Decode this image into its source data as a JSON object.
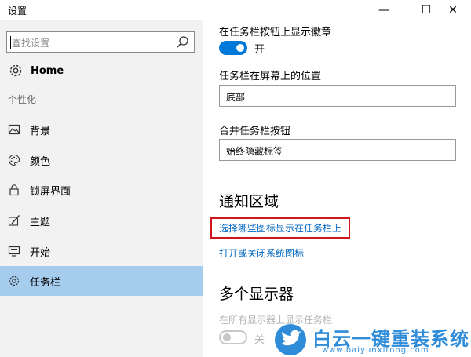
{
  "window": {
    "title": "设置",
    "minimize": "—",
    "maximize": "☐",
    "close": "✕"
  },
  "sidebar": {
    "search_placeholder": "查找设置",
    "home_label": "Home",
    "section_label": "个性化",
    "items": [
      {
        "label": "背景",
        "icon": "image-icon"
      },
      {
        "label": "颜色",
        "icon": "palette-icon"
      },
      {
        "label": "锁屏界面",
        "icon": "lock-icon"
      },
      {
        "label": "主题",
        "icon": "brush-icon"
      },
      {
        "label": "开始",
        "icon": "start-icon"
      },
      {
        "label": "任务栏",
        "icon": "gear-icon",
        "active": true
      }
    ]
  },
  "main": {
    "badges_label": "在任务栏按钮上显示徽章",
    "badges_toggle_state": "开",
    "position_label": "任务栏在屏幕上的位置",
    "position_value": "底部",
    "combine_label": "合并任务栏按钮",
    "combine_value": "始终隐藏标签",
    "notification_heading": "通知区域",
    "link_select_icons": "选择哪些图标显示在任务栏上",
    "link_system_icons": "打开或关闭系统图标",
    "multi_display_heading": "多个显示器",
    "show_all_displays_label": "在所有显示器上显示任务栏",
    "show_all_displays_state": "关"
  },
  "watermark": {
    "title": "白云一键重装系统",
    "url": "www.baiyunxitong.com"
  },
  "colors": {
    "accent": "#0078d7",
    "active_nav": "#a6cdee",
    "link": "#0067c0",
    "highlight": "#d3151c"
  }
}
